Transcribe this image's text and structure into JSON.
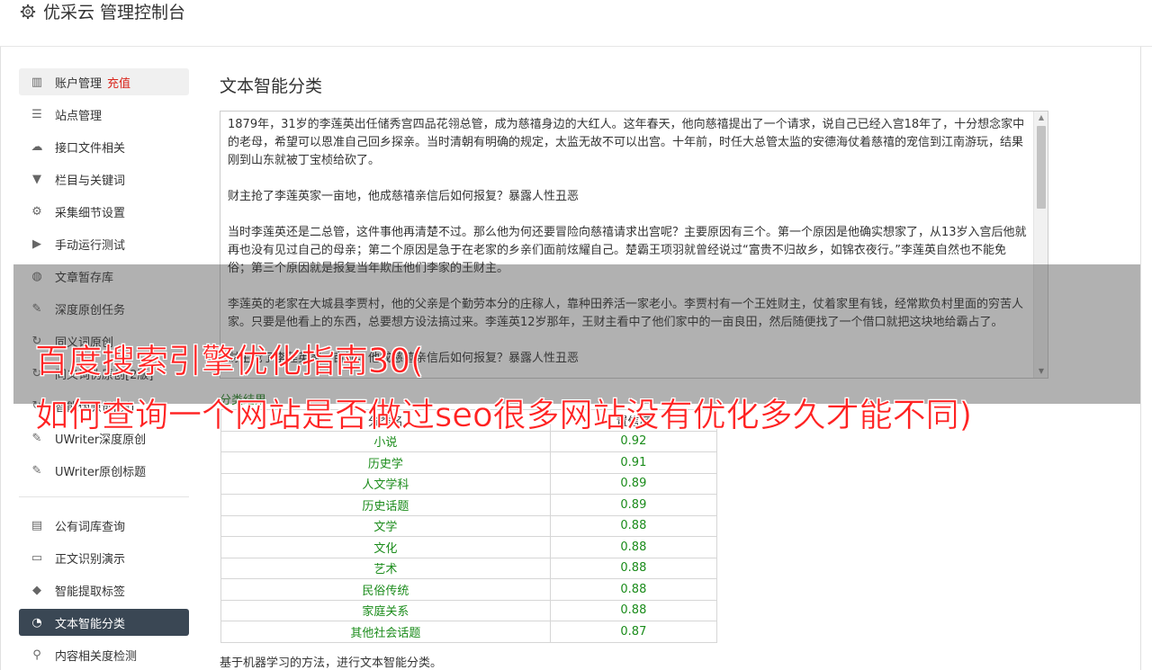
{
  "header": {
    "title": "优采云 管理控制台"
  },
  "sidebar": {
    "group1": [
      {
        "label": "账户管理",
        "extra": "充值",
        "icon": "bar-chart-icon",
        "glyph": "▥"
      },
      {
        "label": "站点管理",
        "icon": "server-icon",
        "glyph": "☰"
      },
      {
        "label": "接口文件相关",
        "icon": "cloud-upload-icon",
        "glyph": "☁"
      },
      {
        "label": "栏目与关键词",
        "icon": "filter-icon",
        "glyph": "▼"
      },
      {
        "label": "采集细节设置",
        "icon": "gears-icon",
        "glyph": "⚙"
      },
      {
        "label": "手动运行测试",
        "icon": "play-circle-icon",
        "glyph": "▶"
      },
      {
        "label": "文章暂存库",
        "icon": "database-icon",
        "glyph": "◍"
      },
      {
        "label": "深度原创任务",
        "icon": "edit-icon",
        "glyph": "✎"
      },
      {
        "label": "同义词原创",
        "icon": "refresh-icon",
        "glyph": "↻"
      },
      {
        "label": "同义词伪原创[2版]",
        "icon": "refresh-icon",
        "glyph": "↻"
      },
      {
        "label": "智能伪原创[测]",
        "icon": "refresh-icon",
        "glyph": "↻"
      },
      {
        "label": "UWriter深度原创",
        "icon": "edit-icon",
        "glyph": "✎"
      },
      {
        "label": "UWriter原创标题",
        "icon": "edit-icon",
        "glyph": "✎"
      }
    ],
    "group2": [
      {
        "label": "公有词库查询",
        "icon": "book-icon",
        "glyph": "▤"
      },
      {
        "label": "正文识别演示",
        "icon": "desktop-icon",
        "glyph": "▭"
      },
      {
        "label": "智能提取标签",
        "icon": "tag-icon",
        "glyph": "◆"
      },
      {
        "label": "文本智能分类",
        "icon": "pie-chart-icon",
        "glyph": "◔"
      },
      {
        "label": "内容相关度检测",
        "icon": "search-icon",
        "glyph": "⚲"
      }
    ]
  },
  "main": {
    "title": "文本智能分类",
    "text": "1879年，31岁的李莲英出任储秀宫四品花翎总管，成为慈禧身边的大红人。这年春天，他向慈禧提出了一个请求，说自己已经入宫18年了，十分想念家中的老母，希望可以恩准自己回乡探亲。当时清朝有明确的规定，太监无故不可以出宫。十年前，时任大总管太监的安德海仗着慈禧的宠信到江南游玩，结果刚到山东就被丁宝桢给砍了。\n\n财主抢了李莲英家一亩地，他成慈禧亲信后如何报复？暴露人性丑恶\n\n当时李莲英还是二总管，这件事他再清楚不过。那么他为何还要冒险向慈禧请求出宫呢？主要原因有三个。第一个原因是他确实想家了，从13岁入宫后他就再也没有见过自己的母亲；第二个原因是急于在老家的乡亲们面前炫耀自己。楚霸王项羽就曾经说过“富贵不归故乡，如锦衣夜行。”李莲英自然也不能免俗；第三个原因就是报复当年欺压他们李家的王财主。\n\n李莲英的老家在大城县李贾村，他的父亲是个勤劳本分的庄稼人，靠种田养活一家老小。李贾村有一个王姓财主，仗着家里有钱，经常欺负村里面的穷苦人家。只要是他看上的东西，总要想方设法搞过来。李莲英12岁那年，王财主看中了他们家中的一亩良田，然后随便找了一个借口就把这块地给霸占了。\n\n财主抢了李莲英家一亩地，他成慈禧亲信后如何报复？暴露人性丑恶",
    "result_label": "分类结果",
    "table_headers": [
      "分类名",
      "置信度"
    ],
    "rows": [
      [
        "小说",
        "0.92"
      ],
      [
        "历史学",
        "0.91"
      ],
      [
        "人文学科",
        "0.89"
      ],
      [
        "历史话题",
        "0.89"
      ],
      [
        "文学",
        "0.88"
      ],
      [
        "文化",
        "0.88"
      ],
      [
        "艺术",
        "0.88"
      ],
      [
        "民俗传统",
        "0.88"
      ],
      [
        "家庭关系",
        "0.88"
      ],
      [
        "其他社会话题",
        "0.87"
      ]
    ],
    "description": "基于机器学习的方法，进行文本智能分类。"
  },
  "overlay": {
    "line1": "百度搜索引擎优化指南30(",
    "line2": "如何查询一个网站是否做过seo很多网站没有优化多久才能不同)"
  },
  "colors": {
    "active_bg": "#3a4754",
    "overlay_text": "#ff2222",
    "result_green": "#1b8c1b",
    "recharge_red": "#d9261c"
  }
}
